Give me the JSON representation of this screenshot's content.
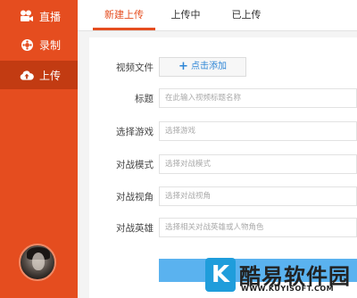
{
  "sidebar": {
    "items": [
      {
        "label": "直播",
        "icon": "camera-icon"
      },
      {
        "label": "录制",
        "icon": "record-icon"
      },
      {
        "label": "上传",
        "icon": "cloud-upload-icon",
        "active": true
      }
    ]
  },
  "tabs": [
    {
      "label": "新建上传",
      "active": true
    },
    {
      "label": "上传中"
    },
    {
      "label": "已上传"
    }
  ],
  "form": {
    "video_file": {
      "label": "视频文件",
      "button": "点击添加"
    },
    "title": {
      "label": "标题",
      "placeholder": "在此输入视频标题名称"
    },
    "game": {
      "label": "选择游戏",
      "placeholder": "选择游戏"
    },
    "mode": {
      "label": "对战模式",
      "placeholder": "选择对战模式"
    },
    "view": {
      "label": "对战视角",
      "placeholder": "选择对战视角"
    },
    "hero": {
      "label": "对战英雄",
      "placeholder": "选择相关对战英雄或人物角色"
    }
  },
  "watermark": {
    "logo_letter": "K",
    "name": "酷易软件园",
    "url": "WWW.KUYISOFT.COM"
  },
  "colors": {
    "accent": "#e54d1f",
    "sidebar_active": "#c23b12",
    "link_blue": "#2e86d6",
    "submit_blue": "#5ab2ef"
  }
}
